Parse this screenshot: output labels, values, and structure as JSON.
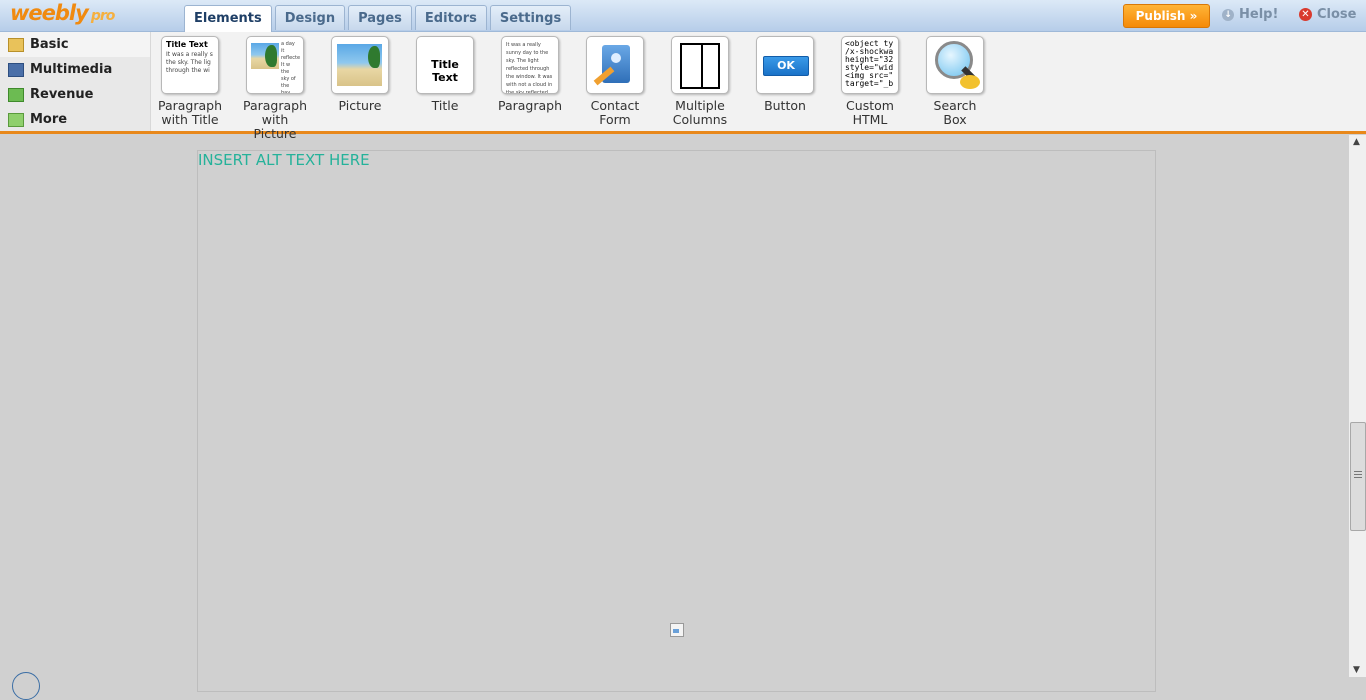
{
  "app": {
    "logo": "weebly",
    "logo_suffix": "pro"
  },
  "tabs": [
    "Elements",
    "Design",
    "Pages",
    "Editors",
    "Settings"
  ],
  "active_tab": "Elements",
  "header": {
    "publish_label": "Publish »",
    "help_label": "Help!",
    "close_label": "Close"
  },
  "sidebar": {
    "items": [
      {
        "label": "Basic",
        "icon": "folder-icon"
      },
      {
        "label": "Multimedia",
        "icon": "film-icon"
      },
      {
        "label": "Revenue",
        "icon": "money-icon"
      },
      {
        "label": "More",
        "icon": "arrow-icon"
      }
    ]
  },
  "elements": [
    {
      "label": "Paragraph with Title",
      "thumb_title": "Title Text",
      "thumb_text": "It was a really s the sky. The lig through the wi"
    },
    {
      "label": "Paragraph with Picture",
      "thumb_text": "a day it reflecte It w the sky of the bay directly through reflected off of the bay dir"
    },
    {
      "label": "Picture"
    },
    {
      "label": "Title",
      "thumb_title": "Title Text"
    },
    {
      "label": "Paragraph",
      "thumb_text": "It was a really sunny day to the sky. The light reflected through the window. It was with not a cloud in the sky reflected off of the bay dire"
    },
    {
      "label": "Contact Form"
    },
    {
      "label": "Multiple Columns"
    },
    {
      "label": "Button",
      "thumb_button": "OK"
    },
    {
      "label": "Custom HTML",
      "thumb_code": "<object ty /x-shockwa height=\"32 style=\"wid <img src=\" target=\"_b"
    },
    {
      "label": "Search Box"
    }
  ],
  "canvas": {
    "alt_text": "INSERT ALT TEXT HERE"
  },
  "colors": {
    "accent": "#e8881b",
    "alt_text": "#25b29a",
    "publish": "#f58a08"
  }
}
